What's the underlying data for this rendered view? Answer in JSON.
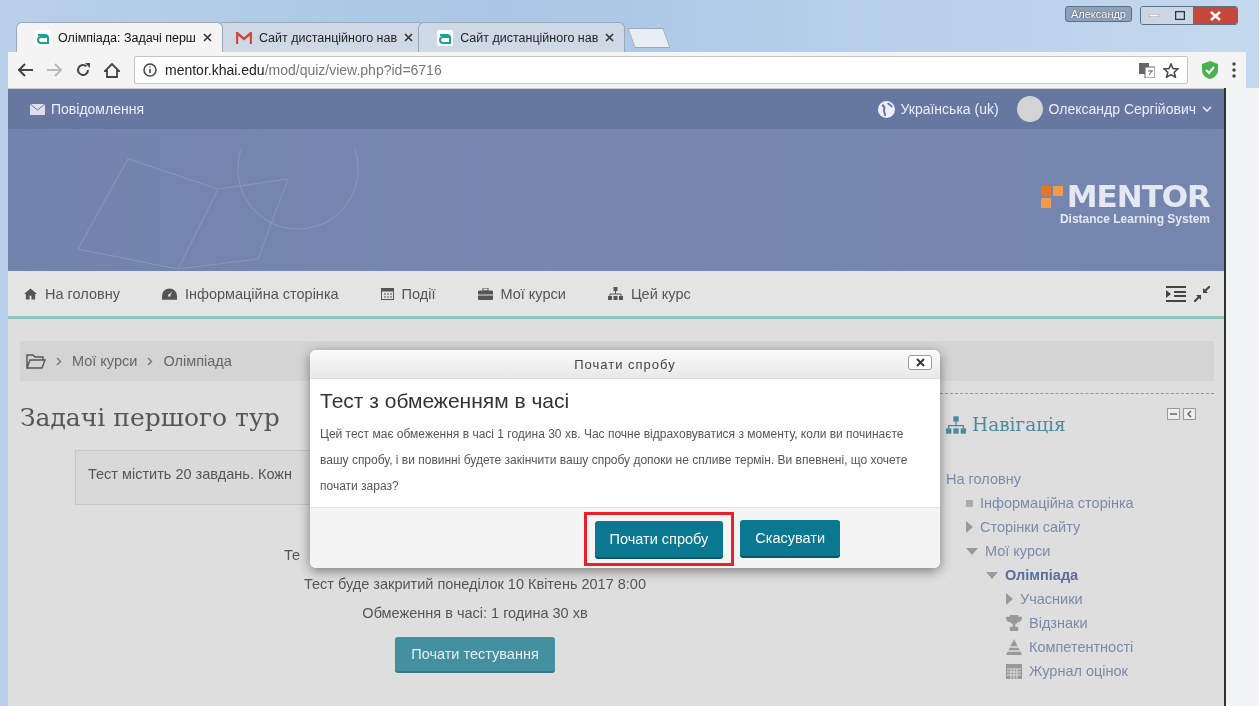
{
  "browser": {
    "tabs": [
      {
        "title": "Олімпіада: Задачі перш",
        "kind": "moodle",
        "selected": true
      },
      {
        "title": "Сайт дистанційного нав",
        "kind": "mail",
        "selected": false
      },
      {
        "title": "Сайт дистанційного нав",
        "kind": "moodle",
        "selected": false
      }
    ],
    "user_badge": "Александр",
    "address": {
      "host": "mentor.khai.edu",
      "path": "/mod/quiz/view.php?id=6716"
    }
  },
  "topbar": {
    "messages": "Повідомлення",
    "language": "Українська (uk)",
    "user": "Олександр Сергійович"
  },
  "logo": {
    "name": "MENTOR",
    "tagline": "Distance Learning System"
  },
  "menu": [
    {
      "label": "На головну",
      "kind": "home"
    },
    {
      "label": "Інформаційна сторінка",
      "kind": "dashboard"
    },
    {
      "label": "Події",
      "kind": "calendar"
    },
    {
      "label": "Мої курси",
      "kind": "briefcase"
    },
    {
      "label": "Цей курс",
      "kind": "sitemap"
    }
  ],
  "breadcrumb": [
    "Мої курси",
    "Олімпіада"
  ],
  "heading": "Задачі першого тур",
  "intro": "Тест містить 20 завдань. Кожн",
  "partial_line": "Те",
  "info_lines": [
    "Тест буде закритий понеділок 10 Квітень 2017 8:00",
    "Обмеження в часі: 1 година 30 хв"
  ],
  "start_button": "Почати тестування",
  "navigation": {
    "title": "Навігація",
    "items": [
      {
        "label": "На головну",
        "selected": false,
        "children": [
          {
            "label": "Інформаційна сторінка",
            "kind": "leaf",
            "selected": false
          },
          {
            "label": "Сторінки сайту",
            "kind": "branch",
            "expanded": false,
            "selected": false
          },
          {
            "label": "Мої курси",
            "kind": "branch",
            "expanded": true,
            "selected": false,
            "children": [
              {
                "label": "Олімпіада",
                "kind": "branch",
                "expanded": true,
                "selected": true,
                "children": [
                  {
                    "label": "Учасники",
                    "kind": "branch",
                    "expanded": false,
                    "selected": false
                  },
                  {
                    "label": "Відзнаки",
                    "kind": "badges",
                    "selected": false
                  },
                  {
                    "label": "Компетентності",
                    "kind": "competencies",
                    "selected": false
                  },
                  {
                    "label": "Журнал оцінок",
                    "kind": "gradebook",
                    "selected": false
                  }
                ]
              }
            ]
          }
        ]
      }
    ]
  },
  "dialog": {
    "title": "Почати спробу",
    "heading": "Тест з обмеженням в часі",
    "text": "Цей тест має обмеження в часі 1 година 30 хв. Час почне відраховуватися з моменту, коли ви починаєте вашу спробу, і ви повинні будете закінчити вашу спробу допоки не спливе термін. Ви впевнені, що хочете почати зараз?",
    "buttons": [
      {
        "label": "Почати спробу",
        "highlighted": true
      },
      {
        "label": "Скасувати",
        "highlighted": false
      }
    ]
  }
}
